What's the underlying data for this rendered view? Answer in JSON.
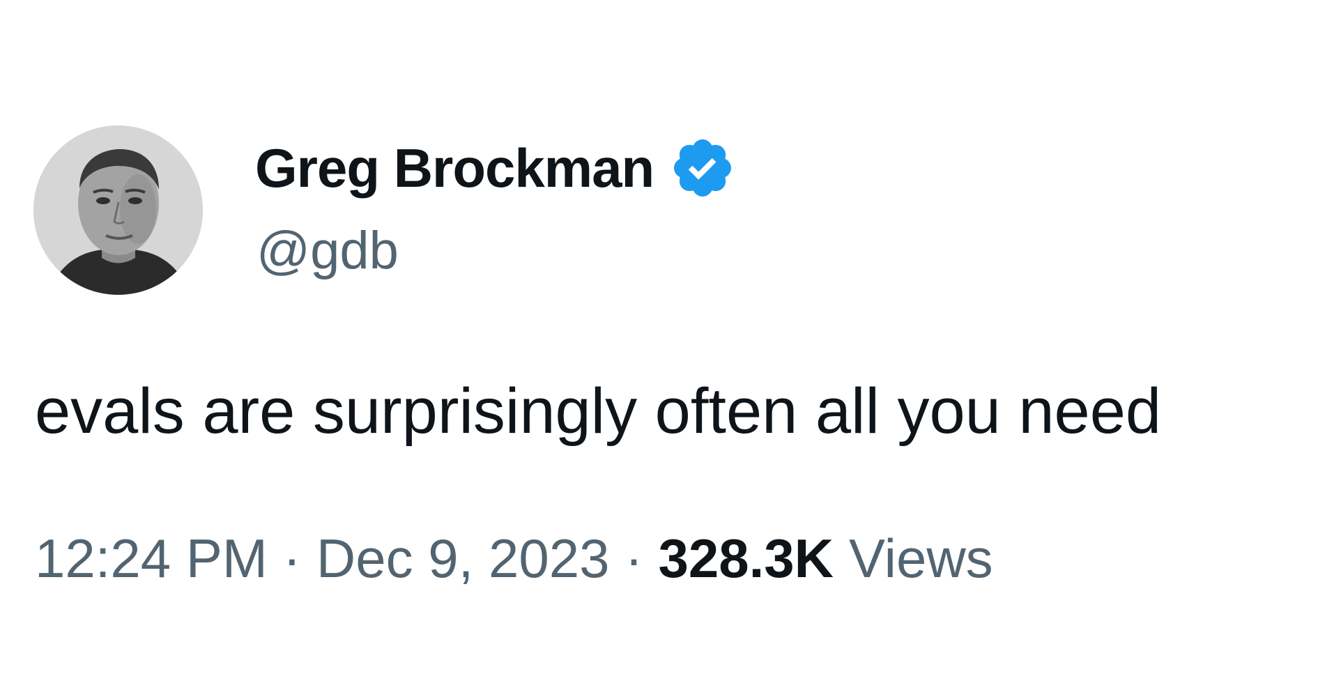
{
  "author": {
    "display_name": "Greg Brockman",
    "handle": "@gdb",
    "verified": true,
    "verified_icon": "verified-badge-icon",
    "avatar": "profile-photo"
  },
  "tweet": {
    "text": "evals are surprisingly often all you need"
  },
  "meta": {
    "time": "12:24 PM",
    "separator": "·",
    "date": "Dec 9, 2023",
    "views_count": "328.3K",
    "views_label": "Views"
  },
  "colors": {
    "text_primary": "#0f1419",
    "text_secondary": "#536471",
    "verified_blue": "#1d9bf0",
    "background": "#ffffff"
  }
}
